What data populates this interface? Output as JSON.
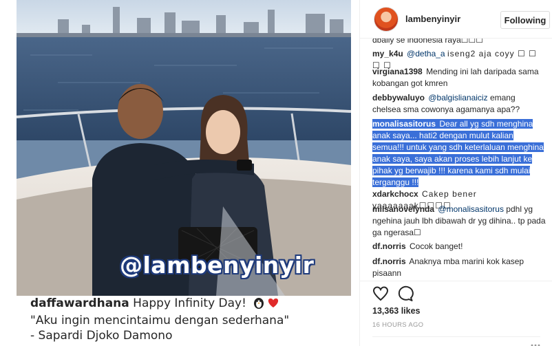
{
  "post": {
    "watermark": "@lambenyinyir",
    "caption": {
      "username": "daffawardhana",
      "line1_text": "Happy Infinity Day!",
      "line2": "\"Aku ingin mencintaimu dengan sederhana\"",
      "line3": "- Sapardi Djoko Damono"
    }
  },
  "header": {
    "username": "lambenyinyir",
    "follow_label": "Following"
  },
  "comments": [
    {
      "username": "",
      "text": "dbally se indonesia raya☐☐☐",
      "mention": ""
    },
    {
      "username": "my_k4u",
      "mention": "@detha_a",
      "text": "iseng2 aja coyy ☐ ☐ ☐ ☐"
    },
    {
      "username": "virgiana1398",
      "mention": "",
      "text": "Mending ini lah daripada sama kobangan got kmren"
    },
    {
      "username": "debbywaluyo",
      "mention": "@balgislianaiciz",
      "text": "emang chelsea sma cowonya agamanya apa??"
    },
    {
      "username": "monalisasitorus",
      "mention": "",
      "text": "Dear all yg sdh menghina anak saya... hati2 dengan mulut kalian semua!!! untuk yang sdh keterlaluan menghina anak saya, saya akan proses lebih lanjut ke pihak yg berwajib !!! karena kami sdh mulai terganggu !!!"
    },
    {
      "username": "xdarkchocx",
      "mention": "",
      "text": "Cakep bener yaaaaaaak☐☐☐☐"
    },
    {
      "username": "milsanovelynda",
      "mention": "@monalisasitorus",
      "text": "pdhl yg ngehina jauh lbh dibawah dr yg dihina.. tp pada ga ngerasa☐"
    },
    {
      "username": "df.norris",
      "mention": "",
      "text": "Cocok banget!"
    },
    {
      "username": "df.norris",
      "mention": "",
      "text": "Anaknya mba marini kok kasep pisaann"
    }
  ],
  "likes": "13,363 likes",
  "time": "16 HOURS AGO",
  "colors": {
    "highlight": "#3a6fd8",
    "mention": "#003569",
    "text": "#262626",
    "muted": "#999999"
  },
  "icons": [
    "heart-icon",
    "comment-icon",
    "more-icon",
    "penguin-emoji-icon",
    "red-heart-emoji-icon"
  ]
}
